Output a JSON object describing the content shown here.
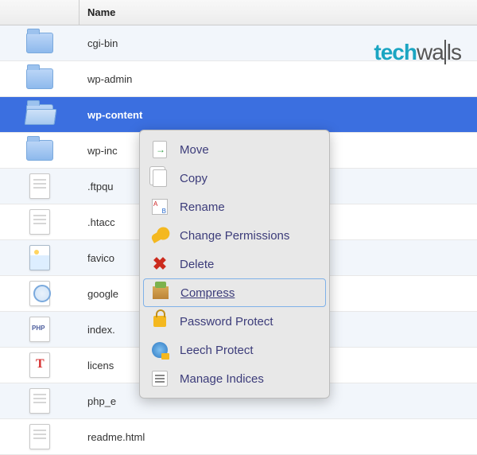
{
  "header": {
    "name_label": "Name"
  },
  "watermark": {
    "part1": "tech",
    "part2": "wa",
    "part3": "ls"
  },
  "rows": [
    {
      "name": "cgi-bin",
      "type": "folder"
    },
    {
      "name": "wp-admin",
      "type": "folder"
    },
    {
      "name": "wp-content",
      "type": "folder",
      "selected": true
    },
    {
      "name": "wp-includes",
      "type": "folder",
      "truncated": "wp-inc"
    },
    {
      "name": ".ftpquota",
      "type": "file",
      "truncated": ".ftpqu"
    },
    {
      "name": ".htaccess",
      "type": "file",
      "truncated": ".htacc"
    },
    {
      "name": "favicon.ico",
      "type": "image",
      "truncated": "favico"
    },
    {
      "name": "google.html",
      "type": "html",
      "truncated": "google"
    },
    {
      "name": "index.php",
      "type": "php",
      "truncated": "index."
    },
    {
      "name": "license.txt",
      "type": "text",
      "truncated": "licens"
    },
    {
      "name": "php_errorlog",
      "type": "file",
      "truncated": "php_e"
    },
    {
      "name": "readme.html",
      "type": "file",
      "truncated": "readme.html"
    }
  ],
  "context_menu": {
    "items": {
      "move": "Move",
      "copy": "Copy",
      "rename": "Rename",
      "change_permissions": "Change Permissions",
      "delete": "Delete",
      "compress": "Compress",
      "password_protect": "Password Protect",
      "leech_protect": "Leech Protect",
      "manage_indices": "Manage Indices"
    },
    "highlighted": "compress"
  }
}
